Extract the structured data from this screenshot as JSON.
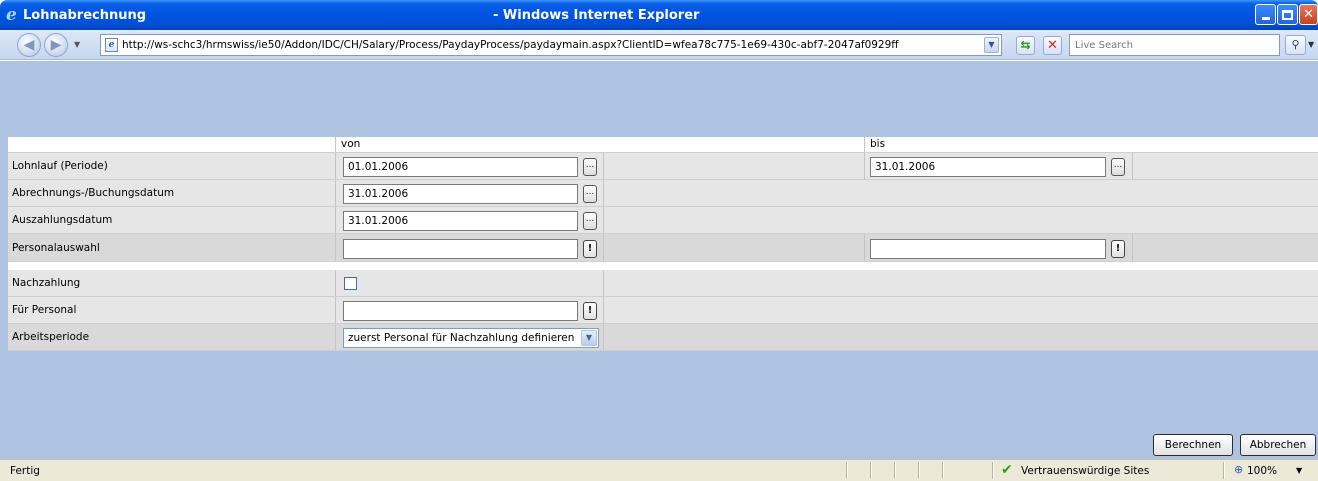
{
  "window": {
    "page_title": "Lohnabrechnung",
    "app_title": "- Windows Internet Explorer"
  },
  "addressbar": {
    "url": "http://ws-schc3/hrmswiss/ie50/Addon/IDC/CH/Salary/Process/PaydayProcess/paydaymain.aspx?ClientID=wfea78c775-1e69-430c-abf7-2047af0929ff",
    "search_placeholder": "Live Search"
  },
  "form": {
    "col_from": "von",
    "col_to": "bis",
    "rows": [
      {
        "label": "Lohnlauf (Periode)",
        "from": "01.01.2006",
        "to": "31.01.2006"
      },
      {
        "label": "Abrechnungs-/Buchungsdatum",
        "from": "31.01.2006"
      },
      {
        "label": "Auszahlungsdatum",
        "from": "31.01.2006"
      },
      {
        "label": "Personalauswahl",
        "from": "",
        "to": ""
      }
    ],
    "nachzahlung_label": "Nachzahlung",
    "nachzahlung_checked": false,
    "fuer_personal_label": "Für Personal",
    "fuer_personal_value": "",
    "arbeitsperiode_label": "Arbeitsperiode",
    "arbeitsperiode_value": "zuerst Personal für Nachzahlung definieren",
    "pick_glyph": "...",
    "alert_glyph": "!"
  },
  "buttons": {
    "calculate": "Berechnen",
    "cancel": "Abbrechen"
  },
  "statusbar": {
    "status": "Fertig",
    "zone": "Vertrauenswürdige Sites",
    "zoom": "100%"
  },
  "colors": {
    "titlebar": "#0054e3",
    "content_bg": "#aec3e1",
    "row_bg": "#e6e6e6",
    "statusbar_bg": "#ece9d8"
  }
}
